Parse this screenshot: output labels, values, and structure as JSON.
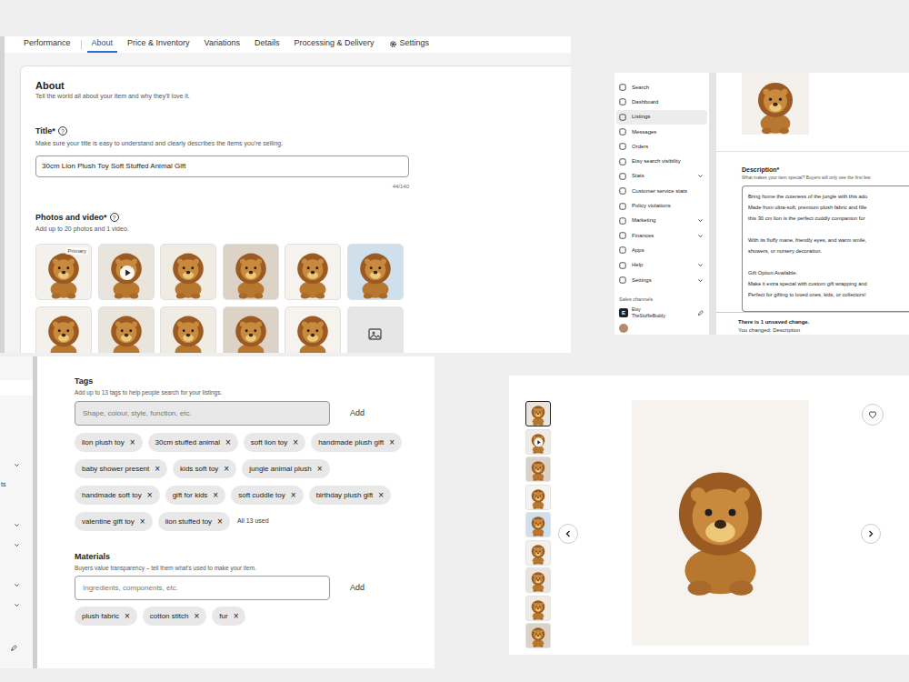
{
  "editor": {
    "tabs": [
      {
        "label": "Performance",
        "selected": false,
        "has_icon": false
      },
      {
        "label": "About",
        "selected": true,
        "has_icon": false
      },
      {
        "label": "Price & Inventory",
        "selected": false,
        "has_icon": false
      },
      {
        "label": "Variations",
        "selected": false,
        "has_icon": false
      },
      {
        "label": "Details",
        "selected": false,
        "has_icon": false
      },
      {
        "label": "Processing & Delivery",
        "selected": false,
        "has_icon": false
      },
      {
        "label": "Settings",
        "selected": false,
        "has_icon": true
      }
    ],
    "heading": "About",
    "subheading": "Tell the world all about your item and why they'll love it.",
    "title_field": {
      "label": "Title",
      "required": "*",
      "help_icon": "?",
      "help": "Make sure your title is easy to understand and clearly describes the items you're selling.",
      "value": "30cm Lion Plush Toy Soft Stuffed Animal Gift",
      "count": "44/140"
    },
    "photos": {
      "label": "Photos and video",
      "required": "*",
      "help_icon": "?",
      "help": "Add up to 20 photos and 1 video.",
      "primary_badge": "Primary",
      "items": [
        {
          "kind": "photo",
          "primary": true
        },
        {
          "kind": "video",
          "primary": false
        },
        {
          "kind": "photo",
          "primary": false
        },
        {
          "kind": "photo",
          "primary": false
        },
        {
          "kind": "photo",
          "primary": false
        },
        {
          "kind": "photo",
          "primary": false
        },
        {
          "kind": "photo",
          "primary": false
        },
        {
          "kind": "photo",
          "primary": false
        },
        {
          "kind": "photo",
          "primary": false
        },
        {
          "kind": "photo",
          "primary": false
        },
        {
          "kind": "photo",
          "primary": false
        },
        {
          "kind": "add",
          "primary": false
        }
      ]
    }
  },
  "dashboard": {
    "nav": [
      {
        "label": "Search",
        "expandable": false,
        "selected": false
      },
      {
        "label": "Dashboard",
        "expandable": false,
        "selected": false
      },
      {
        "label": "Listings",
        "expandable": false,
        "selected": true
      },
      {
        "label": "Messages",
        "expandable": false,
        "selected": false
      },
      {
        "label": "Orders",
        "expandable": false,
        "selected": false
      },
      {
        "label": "Etsy search visibility",
        "expandable": false,
        "selected": false
      },
      {
        "label": "Stats",
        "expandable": true,
        "selected": false
      },
      {
        "label": "Customer service stats",
        "expandable": false,
        "selected": false
      },
      {
        "label": "Policy violations",
        "expandable": false,
        "selected": false
      },
      {
        "label": "Marketing",
        "expandable": true,
        "selected": false
      },
      {
        "label": "Finances",
        "expandable": true,
        "selected": false
      },
      {
        "label": "Apps",
        "expandable": false,
        "selected": false
      },
      {
        "label": "Help",
        "expandable": true,
        "selected": false
      },
      {
        "label": "Settings",
        "expandable": true,
        "selected": false
      }
    ],
    "sales_heading": "Sales channels",
    "channel": {
      "logo": "E",
      "name": "Etsy",
      "shop": "TheStuffieBuddy"
    },
    "description": {
      "label": "Description",
      "required": "*",
      "help": "What makes your item special? Buyers will only see the first few",
      "lines": [
        "Bring home the cuteness of the jungle with this ado",
        "Made from ultra-soft, premium plush fabric and fille",
        "this 30 cm lion is the perfect cuddly companion for",
        "",
        "With its fluffy mane, friendly eyes, and warm smile,",
        "showers, or nursery decoration.",
        "",
        "Gift Option Available:",
        "Make it extra special with custom gift wrapping and",
        "Perfect for gifting to loved ones, kids, or collectors!"
      ]
    },
    "notice": {
      "title": "There is 1 unsaved change.",
      "detail": "You changed: Description"
    }
  },
  "tags_panel": {
    "sidebar_rows": [
      {
        "kind": "highlight",
        "label": "",
        "selected": true
      },
      {
        "kind": "chevron",
        "label": "",
        "selected": false
      },
      {
        "kind": "text",
        "label": "ts",
        "selected": false
      },
      {
        "kind": "blank",
        "label": "",
        "selected": false
      },
      {
        "kind": "chevron",
        "label": "",
        "selected": false
      },
      {
        "kind": "chevron",
        "label": "",
        "selected": false
      },
      {
        "kind": "blank",
        "label": "",
        "selected": false
      },
      {
        "kind": "chevron",
        "label": "",
        "selected": false
      },
      {
        "kind": "chevron",
        "label": "",
        "selected": false
      },
      {
        "kind": "blank",
        "label": "",
        "selected": false
      },
      {
        "kind": "edit",
        "label": "",
        "selected": false
      }
    ],
    "tags": {
      "label": "Tags",
      "help": "Add up to 13 tags to help people search for your listings.",
      "placeholder": "Shape, colour, style, function, etc.",
      "add": "Add",
      "remove_icon": "×",
      "items": [
        "lion plush toy",
        "30cm stuffed animal",
        "soft lion toy",
        "handmade plush gift",
        "baby shower present",
        "kids soft toy",
        "jungle animal plush",
        "handmade soft toy",
        "gift for kids",
        "soft cuddle toy",
        "birthday plush gift",
        "valentine gift toy",
        "lion stuffed toy"
      ],
      "count_note": "All 13 used"
    },
    "materials": {
      "label": "Materials",
      "help": "Buyers value transparency – tell them what's used to make your item.",
      "placeholder": "Ingredients, components, etc.",
      "add": "Add",
      "remove_icon": "×",
      "items": [
        "plush fabric",
        "cotton stitch",
        "fur"
      ]
    }
  },
  "product_page": {
    "thumbnails": [
      {
        "kind": "photo",
        "selected": true
      },
      {
        "kind": "video",
        "selected": false
      },
      {
        "kind": "photo",
        "selected": false
      },
      {
        "kind": "photo",
        "selected": false
      },
      {
        "kind": "photo",
        "selected": false
      },
      {
        "kind": "photo",
        "selected": false
      },
      {
        "kind": "photo",
        "selected": false
      },
      {
        "kind": "photo",
        "selected": false
      },
      {
        "kind": "photo",
        "selected": false
      }
    ],
    "favorited": false
  }
}
